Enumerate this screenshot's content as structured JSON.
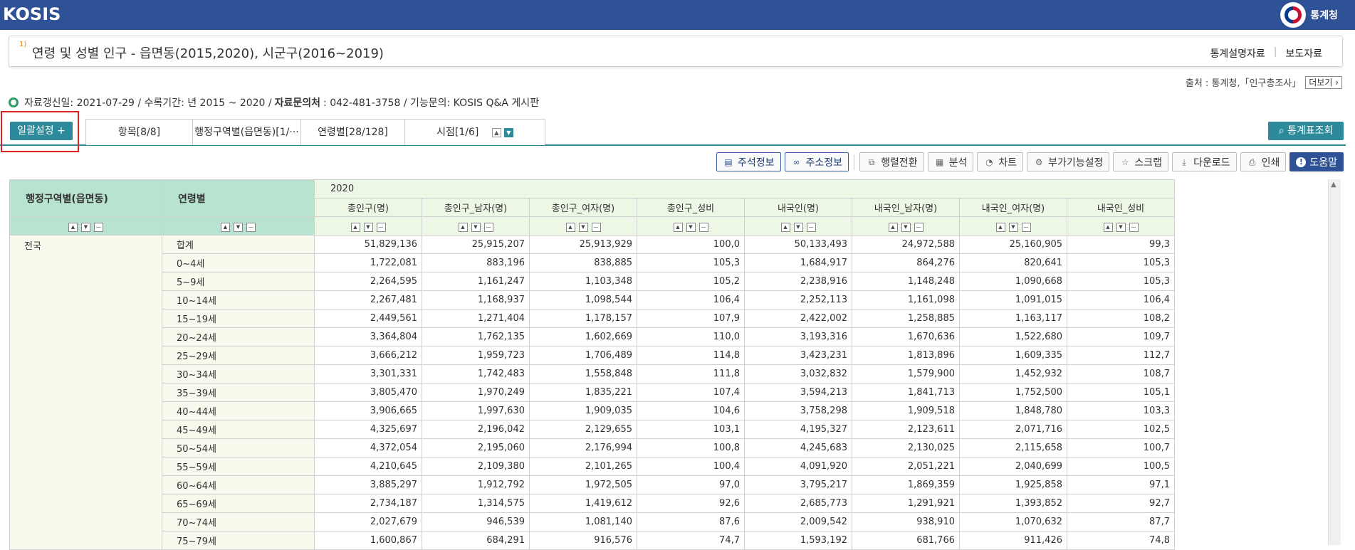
{
  "header": {
    "logo": "KOSIS",
    "agency": "통계청"
  },
  "title": {
    "superscript": "1)",
    "text": "연령 및 성별 인구 - 읍면동(2015,2020), 시군구(2016~2019)",
    "links": [
      "통계설명자료",
      "보도자료"
    ]
  },
  "source": {
    "text": "출처 : 통계청,「인구총조사」",
    "more_label": "더보기 ›"
  },
  "meta": {
    "updated": "자료갱신일: 2021-07-29 / 수록기간: 년 2015 ~ 2020 / ",
    "contact_label": "자료문의처",
    "contact_value": " : 042-481-3758 / 기능문의: KOSIS Q&A 게시판"
  },
  "filter": {
    "bulk_button": "일괄설정 +",
    "tabs": [
      "항목[8/8]",
      "행정구역별(읍면동)[1/···",
      "연령별[28/128]",
      "시점[1/6]"
    ],
    "stat_button": "통계표조회"
  },
  "toolbar": {
    "buttons": [
      "주석정보",
      "주소정보",
      "행렬전환",
      "분석",
      "차트",
      "부가기능설정",
      "스크랩",
      "다운로드",
      "인쇄",
      "도움말"
    ]
  },
  "table": {
    "row_header_1": "행정구역별(읍면동)",
    "row_header_2": "연령별",
    "year": "2020",
    "columns": [
      "총인구(명)",
      "총인구_남자(명)",
      "총인구_여자(명)",
      "총인구_성비",
      "내국인(명)",
      "내국인_남자(명)",
      "내국인_여자(명)",
      "내국인_성비"
    ],
    "region": "전국",
    "rows": [
      {
        "age": "합계",
        "values": [
          "51,829,136",
          "25,915,207",
          "25,913,929",
          "100,0",
          "50,133,493",
          "24,972,588",
          "25,160,905",
          "99,3"
        ]
      },
      {
        "age": "0~4세",
        "values": [
          "1,722,081",
          "883,196",
          "838,885",
          "105,3",
          "1,684,917",
          "864,276",
          "820,641",
          "105,3"
        ]
      },
      {
        "age": "5~9세",
        "values": [
          "2,264,595",
          "1,161,247",
          "1,103,348",
          "105,2",
          "2,238,916",
          "1,148,248",
          "1,090,668",
          "105,3"
        ]
      },
      {
        "age": "10~14세",
        "values": [
          "2,267,481",
          "1,168,937",
          "1,098,544",
          "106,4",
          "2,252,113",
          "1,161,098",
          "1,091,015",
          "106,4"
        ]
      },
      {
        "age": "15~19세",
        "values": [
          "2,449,561",
          "1,271,404",
          "1,178,157",
          "107,9",
          "2,422,002",
          "1,258,885",
          "1,163,117",
          "108,2"
        ]
      },
      {
        "age": "20~24세",
        "values": [
          "3,364,804",
          "1,762,135",
          "1,602,669",
          "110,0",
          "3,193,316",
          "1,670,636",
          "1,522,680",
          "109,7"
        ]
      },
      {
        "age": "25~29세",
        "values": [
          "3,666,212",
          "1,959,723",
          "1,706,489",
          "114,8",
          "3,423,231",
          "1,813,896",
          "1,609,335",
          "112,7"
        ]
      },
      {
        "age": "30~34세",
        "values": [
          "3,301,331",
          "1,742,483",
          "1,558,848",
          "111,8",
          "3,032,832",
          "1,579,900",
          "1,452,932",
          "108,7"
        ]
      },
      {
        "age": "35~39세",
        "values": [
          "3,805,470",
          "1,970,249",
          "1,835,221",
          "107,4",
          "3,594,213",
          "1,841,713",
          "1,752,500",
          "105,1"
        ]
      },
      {
        "age": "40~44세",
        "values": [
          "3,906,665",
          "1,997,630",
          "1,909,035",
          "104,6",
          "3,758,298",
          "1,909,518",
          "1,848,780",
          "103,3"
        ]
      },
      {
        "age": "45~49세",
        "values": [
          "4,325,697",
          "2,196,042",
          "2,129,655",
          "103,1",
          "4,195,327",
          "2,123,611",
          "2,071,716",
          "102,5"
        ]
      },
      {
        "age": "50~54세",
        "values": [
          "4,372,054",
          "2,195,060",
          "2,176,994",
          "100,8",
          "4,245,683",
          "2,130,025",
          "2,115,658",
          "100,7"
        ]
      },
      {
        "age": "55~59세",
        "values": [
          "4,210,645",
          "2,109,380",
          "2,101,265",
          "100,4",
          "4,091,920",
          "2,051,221",
          "2,040,699",
          "100,5"
        ]
      },
      {
        "age": "60~64세",
        "values": [
          "3,885,297",
          "1,912,792",
          "1,972,505",
          "97,0",
          "3,795,217",
          "1,869,359",
          "1,925,858",
          "97,1"
        ]
      },
      {
        "age": "65~69세",
        "values": [
          "2,734,187",
          "1,314,575",
          "1,419,612",
          "92,6",
          "2,685,773",
          "1,291,921",
          "1,393,852",
          "92,7"
        ]
      },
      {
        "age": "70~74세",
        "values": [
          "2,027,679",
          "946,539",
          "1,081,140",
          "87,6",
          "2,009,542",
          "938,910",
          "1,070,632",
          "87,7"
        ]
      },
      {
        "age": "75~79세",
        "values": [
          "1,600,867",
          "684,291",
          "916,576",
          "74,7",
          "1,593,192",
          "681,766",
          "911,426",
          "74,8"
        ]
      }
    ]
  }
}
